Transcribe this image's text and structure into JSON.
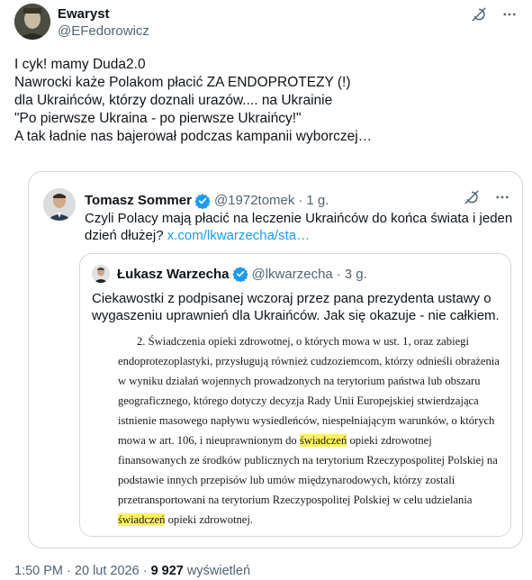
{
  "author": {
    "display_name": "Ewaryst",
    "handle": "@EFedorowicz"
  },
  "tweet_lines": [
    "I cyk! mamy Duda2.0",
    "Nawrocki każe Polakom płacić ZA ENDOPROTEZY (!)",
    "dla Ukraińców, którzy doznali urazów.... na Ukrainie",
    "\"Po pierwsze Ukraina - po pierwsze Ukraińcy!\"",
    "A tak ładnie nas bajerował podczas kampanii wyborczej…"
  ],
  "quote": {
    "display_name": "Tomasz Sommer",
    "handle": "@1972tomek",
    "separator": "·",
    "time": "1 g.",
    "text_line1": "Czyli Polacy mają płacić na leczenie Ukraińców do końca świata i jeden",
    "text_line2": "dzień dłużej?",
    "link": "x.com/lkwarzecha/sta…"
  },
  "inner_quote": {
    "display_name": "Łukasz Warzecha",
    "handle": "@lkwarzecha",
    "separator": "·",
    "time": "3 g.",
    "text_lines": [
      "Ciekawostki z podpisanej wczoraj przez pana prezydenta ustawy o",
      "wygaszeniu uprawnień dla Ukraińców. Jak się okazuje - nie całkiem."
    ]
  },
  "document": {
    "line1": "2. Świadczenia opieki zdrowotnej, o których mowa w ust. 1, oraz zabiegi",
    "line2": "endoprotezoplastyki, przysługują również cudzoziemcom, którzy odnieśli obrażenia",
    "line3": "w wyniku działań wojennych prowadzonych na terytorium państwa lub obszaru",
    "line4": "geograficznego, którego dotyczy decyzja Rady Unii Europejskiej stwierdzająca",
    "line5": "istnienie masowego napływu wysiedleńców, niespełniającym warunków, o których",
    "line6_pre": "mowa w art. 106, i nieuprawnionym do",
    "line6_hl": "świadczeń",
    "line6_post": "opieki zdrowotnej",
    "line7": "finansowanych ze środków publicznych na terytorium Rzeczypospolitej Polskiej na",
    "line8": "podstawie innych przepisów lub umów międzynarodowych, którzy zostali",
    "line9": "przetransportowani na terytorium Rzeczypospolitej Polskiej w celu udzielania",
    "line10_hl": "świadczeń",
    "line10_post": "opieki zdrowotnej.",
    "highlight_color": "#fff35b"
  },
  "footer": {
    "time": "1:50 PM",
    "sep": "·",
    "date": "20 lut 2026",
    "sep2": "·",
    "views": "9 927",
    "views_label": "wyświetleń"
  },
  "icons": {
    "grok": "grok-icon",
    "more": "more-icon",
    "verified": "verified-badge-icon"
  },
  "colors": {
    "link": "#1d9bf0",
    "muted": "#536471",
    "text": "#0f1419",
    "border": "#cfd9de",
    "verified": "#1d9bf0"
  }
}
